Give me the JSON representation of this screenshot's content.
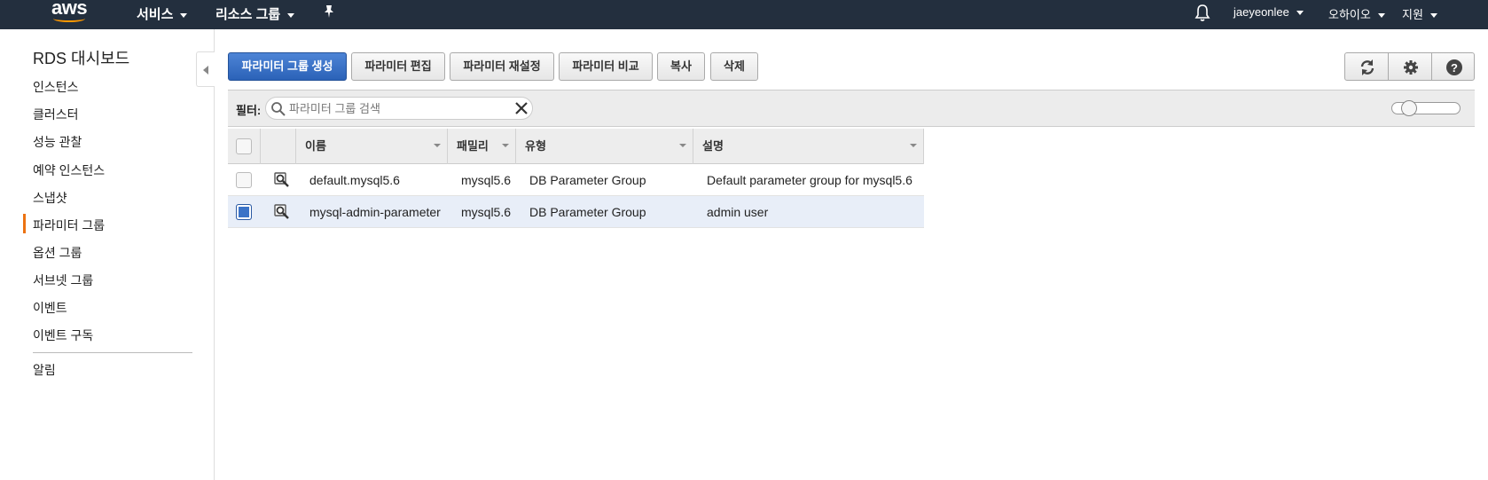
{
  "topnav": {
    "logo": "aws",
    "services": "서비스",
    "resource_groups": "리소스 그룹",
    "user": "jaeyeonlee",
    "region": "오하이오",
    "support": "지원"
  },
  "sidebar": {
    "title": "RDS 대시보드",
    "items": [
      {
        "label": "인스턴스"
      },
      {
        "label": "클러스터"
      },
      {
        "label": "성능 관찰"
      },
      {
        "label": "예약 인스턴스"
      },
      {
        "label": "스냅샷"
      },
      {
        "label": "파라미터 그룹"
      },
      {
        "label": "옵션 그룹"
      },
      {
        "label": "서브넷 그룹"
      },
      {
        "label": "이벤트"
      },
      {
        "label": "이벤트 구독"
      }
    ],
    "active_item": "파라미터 그룹",
    "footer_item": "알림"
  },
  "toolbar": {
    "create": "파라미터 그룹 생성",
    "edit": "파라미터 편집",
    "reset": "파라미터 재설정",
    "compare": "파라미터 비교",
    "copy": "복사",
    "delete": "삭제"
  },
  "icons": {
    "refresh": "refresh-icon",
    "settings": "gear-icon",
    "help": "help-icon"
  },
  "filter": {
    "label": "필터:",
    "placeholder": "파라미터 그룹 검색",
    "value": ""
  },
  "table": {
    "headers": {
      "name": "이름",
      "family": "패밀리",
      "type": "유형",
      "description": "설명"
    },
    "rows": [
      {
        "name": "default.mysql5.6",
        "family": "mysql5.6",
        "type": "DB Parameter Group",
        "description": "Default parameter group for mysql5.6",
        "selected": false
      },
      {
        "name": "mysql-admin-parameter",
        "family": "mysql5.6",
        "type": "DB Parameter Group",
        "description": "admin user",
        "selected": true
      }
    ]
  },
  "colors": {
    "nav_bg": "#232f3e",
    "accent": "#ec7211",
    "primary_button": "#2b62b8",
    "selected_row": "#e8eef8"
  }
}
